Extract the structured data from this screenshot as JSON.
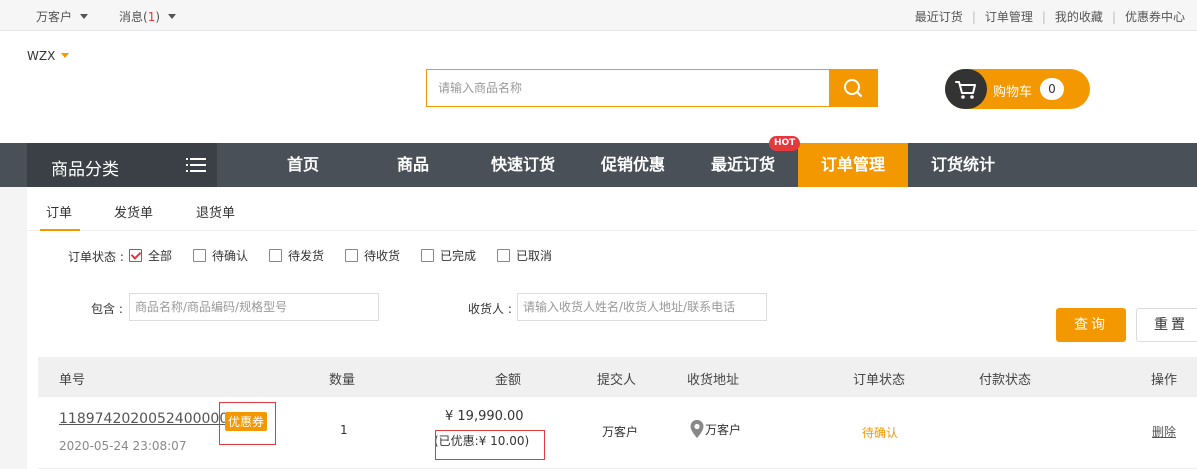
{
  "topbar": {
    "account": "万客户",
    "messages_label": "消息",
    "messages_open": "(",
    "messages_count": "1",
    "messages_close": ")",
    "links": [
      "最近订货",
      "订单管理",
      "我的收藏",
      "优惠券中心"
    ]
  },
  "header": {
    "user": "WZX",
    "search_placeholder": "请输入商品名称",
    "cart_label": "购物车",
    "cart_count": "0"
  },
  "nav": {
    "category_label": "商品分类",
    "links": [
      "首页",
      "商品",
      "快速订货",
      "促销优惠",
      "最近订货",
      "订单管理",
      "订货统计"
    ],
    "hot_badge": "HOT",
    "active_index": 5
  },
  "tabs": [
    "订单",
    "发货单",
    "退货单"
  ],
  "filters": {
    "status_label": "订单状态 :",
    "statuses": [
      {
        "label": "全部",
        "checked": true
      },
      {
        "label": "待确认",
        "checked": false
      },
      {
        "label": "待发货",
        "checked": false
      },
      {
        "label": "待收货",
        "checked": false
      },
      {
        "label": "已完成",
        "checked": false
      },
      {
        "label": "已取消",
        "checked": false
      }
    ],
    "contains_label": "包含 :",
    "contains_placeholder": "商品名称/商品编码/规格型号",
    "receiver_label": "收货人 :",
    "receiver_placeholder": "请输入收货人姓名/收货人地址/联系电话",
    "query_label": "查询",
    "reset_label": "重置"
  },
  "table": {
    "headers": [
      "单号",
      "数量",
      "金额",
      "提交人",
      "收货地址",
      "订单状态",
      "付款状态",
      "操作"
    ],
    "rows": [
      {
        "order_no": "11897420200524000003",
        "coupon_tag": "优惠券",
        "date": "2020-05-24 23:08:07",
        "quantity": "1",
        "amount": "¥ 19,990.00",
        "discount": "(已优惠:¥ 10.00)",
        "submitter": "万客户",
        "address": "万客户",
        "order_status": "待确认",
        "payment_status": "",
        "action": "删除"
      }
    ]
  },
  "colors": {
    "accent": "#f39800",
    "nav_bg": "#4a5057",
    "highlight_red": "#e4393c"
  }
}
